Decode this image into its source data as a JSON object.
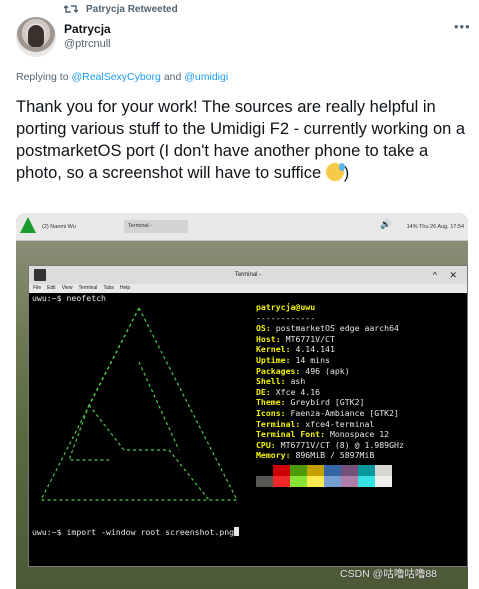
{
  "retweet": {
    "label": "Patrycja Retweeted"
  },
  "author": {
    "name": "Patrycja",
    "handle": "@ptrcnull"
  },
  "more_label": "•••",
  "reply": {
    "prefix": "Replying to ",
    "mention1": "@RealSexyCyborg",
    "and": " and ",
    "mention2": "@umidigi"
  },
  "tweet": {
    "text": "Thank you for your work! The sources are really helpful in porting various stuff to the Umidigi F2 - currently working on a postmarketOS port (I don't have another phone to take a photo, so a screenshot will have to suffice",
    "tail": ")"
  },
  "screenshot": {
    "panel": {
      "task1": "(2) Naomi Wu",
      "task2": "Terminal -",
      "tray": "14%  Thu 26 Aug, 17:54"
    },
    "terminal": {
      "title": "Terminal -",
      "menu": [
        "File",
        "Edit",
        "View",
        "Terminal",
        "Tabs",
        "Help"
      ],
      "prompt1": "uwu:~$ neofetch",
      "prompt2": "uwu:~$ import -window root screenshot.png",
      "neofetch": {
        "user": "patrycja@uwu",
        "sep": "------------",
        "rows": [
          {
            "key": "OS:",
            "val": " postmarketOS edge aarch64"
          },
          {
            "key": "Host:",
            "val": " MT6771V/CT"
          },
          {
            "key": "Kernel:",
            "val": " 4.14.141"
          },
          {
            "key": "Uptime:",
            "val": " 14 mins"
          },
          {
            "key": "Packages:",
            "val": " 496 (apk)"
          },
          {
            "key": "Shell:",
            "val": " ash"
          },
          {
            "key": "DE:",
            "val": " Xfce 4.16"
          },
          {
            "key": "Theme:",
            "val": " Greybird [GTK2]"
          },
          {
            "key": "Icons:",
            "val": " Faenza-Ambiance [GTK2]"
          },
          {
            "key": "Terminal:",
            "val": " xfce4-terminal"
          },
          {
            "key": "Terminal Font:",
            "val": " Monospace 12"
          },
          {
            "key": "CPU:",
            "val": " MT6771V/CT (8) @ 1.989GHz"
          },
          {
            "key": "Memory:",
            "val": " 896MiB / 5897MiB"
          }
        ],
        "palette_top": [
          "#000000",
          "#cc0000",
          "#4e9a06",
          "#c4a000",
          "#3465a4",
          "#75507b",
          "#06989a",
          "#d3d7cf"
        ],
        "palette_bottom": [
          "#555753",
          "#ef2929",
          "#8ae234",
          "#fce94f",
          "#729fcf",
          "#ad7fa8",
          "#34e2e2",
          "#eeeeec"
        ]
      }
    }
  },
  "watermark": "CSDN @咕噜咕噜88"
}
